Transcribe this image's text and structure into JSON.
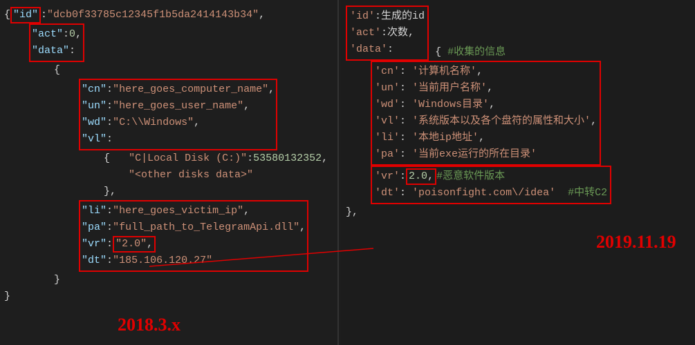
{
  "left": {
    "id_key": "\"id\"",
    "id_val": "\"dcb0f33785c12345f1b5da2414143b34\"",
    "act_key": "\"act\"",
    "act_val": "0",
    "data_key": "\"data\"",
    "cn_key": "\"cn\"",
    "cn_val": "\"here_goes_computer_name\"",
    "un_key": "\"un\"",
    "un_val": "\"here_goes_user_name\"",
    "wd_key": "\"wd\"",
    "wd_val": "\"C:\\\\Windows\"",
    "vl_key": "\"vl\"",
    "vl_disk_key": "\"C|Local Disk (C:)\"",
    "vl_disk_val": "53580132352",
    "vl_other": "\"<other disks data>\"",
    "li_key": "\"li\"",
    "li_val": "\"here_goes_victim_ip\"",
    "pa_key": "\"pa\"",
    "pa_val": "\"full_path_to_TelegramApi.dll\"",
    "vr_key": "\"vr\"",
    "vr_val": "\"2.0\"",
    "dt_key": "\"dt\"",
    "dt_val": "\"185.106.120.27\""
  },
  "right": {
    "id_key": "'id'",
    "id_val": "生成的id",
    "act_key": "'act'",
    "act_val": "次数",
    "data_key": "'data'",
    "data_comment": "#收集的信息",
    "cn_key": "'cn'",
    "cn_val": "'计算机名称'",
    "un_key": "'un'",
    "un_val": "'当前用户名称'",
    "wd_key": "'wd'",
    "wd_val": "'Windows目录'",
    "vl_key": "'vl'",
    "vl_val": "'系统版本以及各个盘符的属性和大小'",
    "li_key": "'li'",
    "li_val": "'本地ip地址'",
    "pa_key": "'pa'",
    "pa_val": "'当前exe运行的所在目录'",
    "vr_key": "'vr'",
    "vr_val": "2.0",
    "vr_comment": "#恶意软件版本",
    "dt_key": "'dt'",
    "dt_val": "'poisonfight.com\\/idea'",
    "dt_comment": "#中转C2"
  },
  "annotations": {
    "left_date": "2018.3.x",
    "right_date": "2019.11.19"
  }
}
